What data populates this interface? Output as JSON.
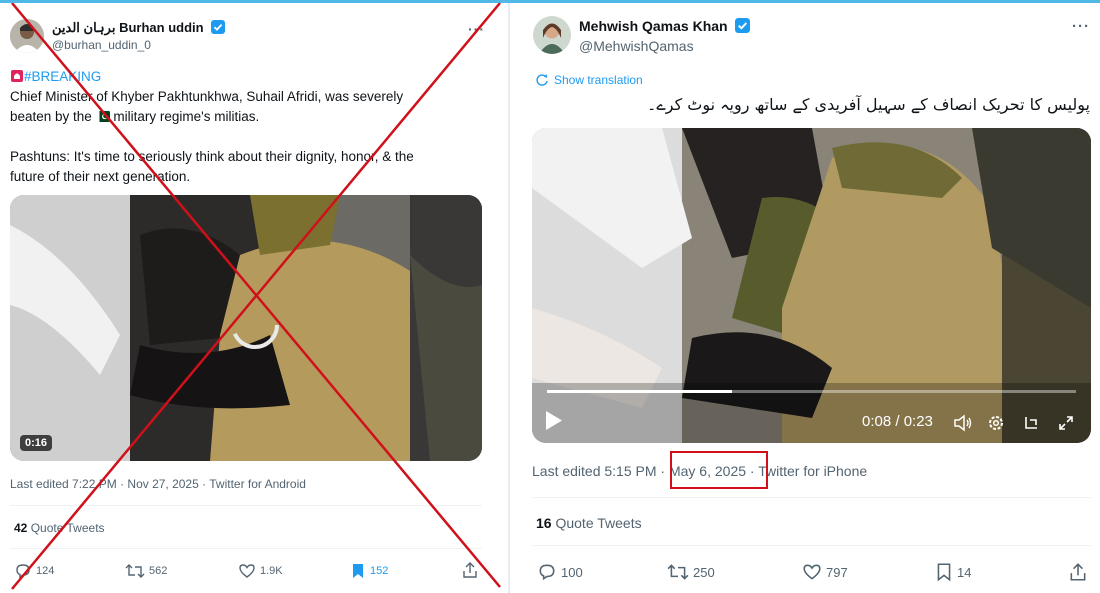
{
  "left_tweet": {
    "author_name": "Burhan uddin",
    "author_name_urdu": "برہان الدين",
    "handle": "@burhan_uddin_0",
    "more_label": "···",
    "hashtag": "#BREAKING",
    "text_line1": "Chief Minister of Khyber Pakhtunkhwa, Suhail Afridi, was severely",
    "text_line2_a": "beaten by the",
    "text_line2_b": "military regime's militias.",
    "text_line3": "Pashtuns: It's time to seriously think about their dignity, honor, & the",
    "text_line4": "future of their next generation.",
    "video_duration": "0:16",
    "meta_line": "Last edited 7:22 PM · Nov 27, 2025 · Twitter for Android",
    "quote_count": "42",
    "quote_label": "Quote Tweets",
    "replies": "124",
    "retweets": "562",
    "likes": "1.9K",
    "bookmarks": "152",
    "bookmark_color": "#1d9bf0",
    "crossed_out_color": "#d0101a"
  },
  "right_tweet": {
    "author_name": "Mehwish Qamas Khan",
    "handle": "@MehwishQamas",
    "more_label": "···",
    "show_translation": "Show translation",
    "text_urdu": "پولیس کا تحریک انصاف کے سہیل آفریدی کے ساتھ رویہ نوٹ کرے۔",
    "video_time": "0:08 / 0:23",
    "progress": 0.35,
    "meta_prefix": "Last edited 5:15 PM ·",
    "meta_date": "May 6, 2025",
    "meta_suffix": "· Twitter for iPhone",
    "highlight_color": "#d0101a",
    "quote_count": "16",
    "quote_label": "Quote Tweets",
    "replies": "100",
    "retweets": "250",
    "likes": "797",
    "bookmarks": "14"
  }
}
